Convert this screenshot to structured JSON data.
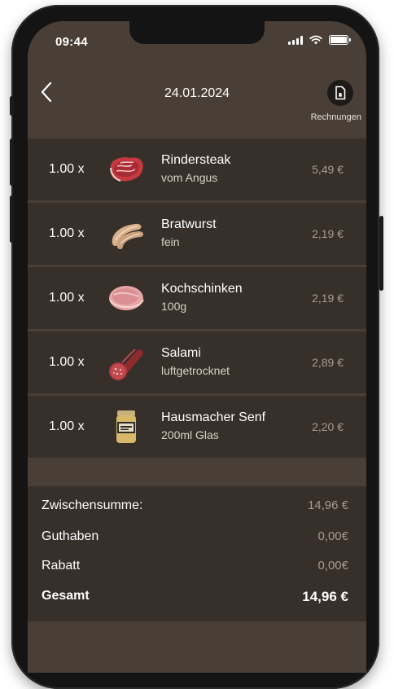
{
  "status": {
    "time": "09:44"
  },
  "header": {
    "date": "24.01.2024",
    "invoices_label": "Rechnungen"
  },
  "items": [
    {
      "qty": "1.00 x",
      "name": "Rindersteak",
      "sub": "vom Angus",
      "price": "5,49 €",
      "icon": "steak-image"
    },
    {
      "qty": "1.00 x",
      "name": "Bratwurst",
      "sub": "fein",
      "price": "2,19 €",
      "icon": "sausage-image"
    },
    {
      "qty": "1.00 x",
      "name": "Kochschinken",
      "sub": "100g",
      "price": "2,19 €",
      "icon": "ham-image"
    },
    {
      "qty": "1.00 x",
      "name": "Salami",
      "sub": "luftgetrocknet",
      "price": "2,89 €",
      "icon": "salami-image"
    },
    {
      "qty": "1.00 x",
      "name": "Hausmacher Senf",
      "sub": "200ml Glas",
      "price": "2,20 €",
      "icon": "mustard-jar-image"
    }
  ],
  "summary": {
    "subtotal_label": "Zwischensumme:",
    "subtotal": "14,96 €",
    "credit_label": "Guthaben",
    "credit": "0,00€",
    "discount_label": "Rabatt",
    "discount": "0,00€",
    "total_label": "Gesamt",
    "total": "14,96 €"
  },
  "colors": {
    "background": "#4a3f36",
    "row": "#362f2a",
    "muted_text": "#a79d93"
  }
}
